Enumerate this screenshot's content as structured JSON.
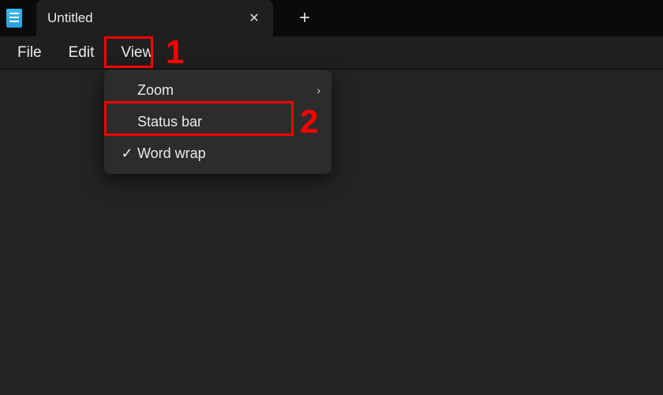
{
  "titlebar": {
    "tab_title": "Untitled",
    "close_glyph": "✕",
    "new_tab_glyph": "+"
  },
  "menubar": {
    "file": "File",
    "edit": "Edit",
    "view": "View"
  },
  "dropdown": {
    "zoom": "Zoom",
    "status_bar": "Status bar",
    "word_wrap": "Word wrap",
    "check_glyph": "✓",
    "chevron_glyph": "›"
  },
  "callouts": {
    "one": "1",
    "two": "2"
  }
}
